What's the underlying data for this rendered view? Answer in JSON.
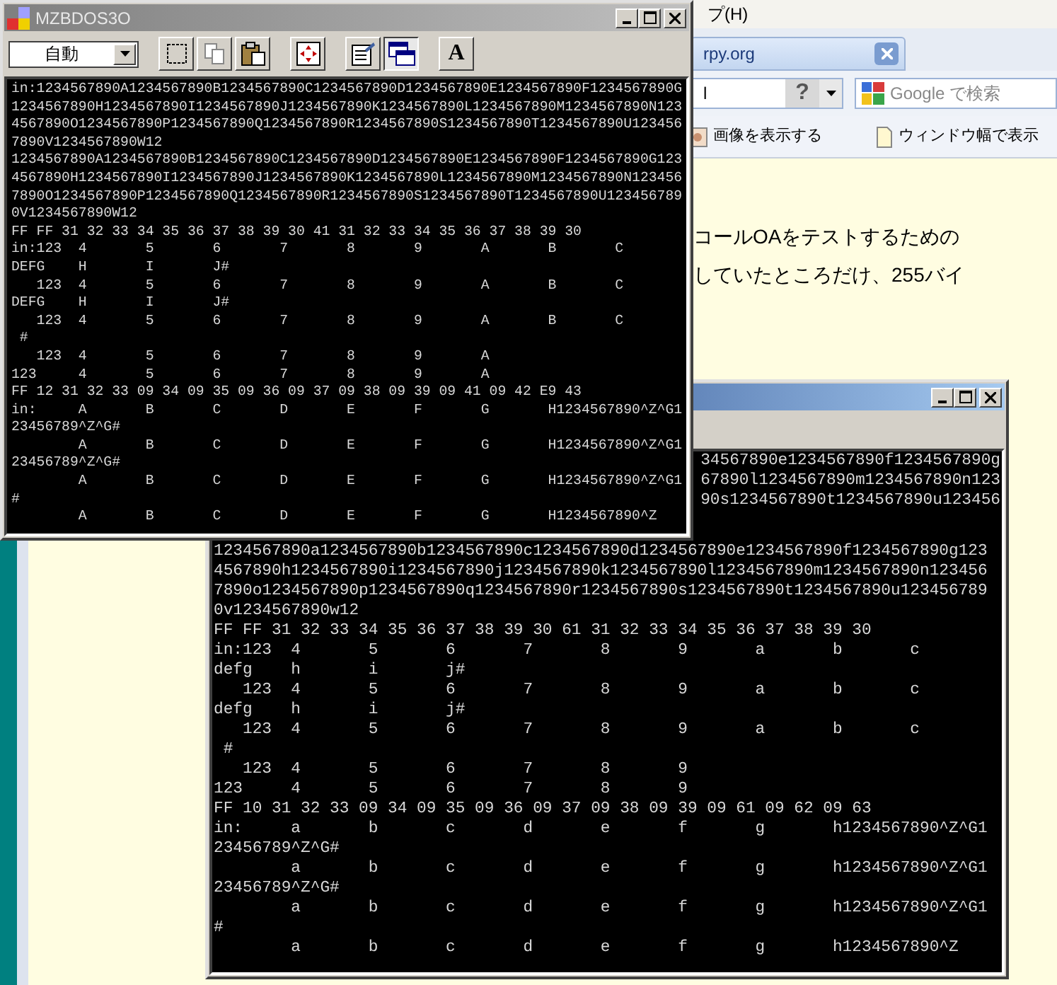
{
  "front_window": {
    "title": "MZBDOS3O",
    "encoding": "自動",
    "tools": [
      {
        "kind": "select",
        "selected": false
      },
      {
        "kind": "copy",
        "selected": false
      },
      {
        "kind": "paste",
        "selected": false
      },
      {
        "kind": "fullscreen",
        "selected": false
      },
      {
        "kind": "properties",
        "selected": false
      },
      {
        "kind": "background",
        "selected": true
      },
      {
        "kind": "font",
        "label": "A",
        "selected": false
      }
    ],
    "lines": [
      "in:1234567890A1234567890B1234567890C1234567890D1234567890E1234567890F1234567890G",
      "1234567890H1234567890I1234567890J1234567890K1234567890L1234567890M1234567890N123",
      "4567890O1234567890P1234567890Q1234567890R1234567890S1234567890T1234567890U123456",
      "7890V1234567890W12",
      "1234567890A1234567890B1234567890C1234567890D1234567890E1234567890F1234567890G123",
      "4567890H1234567890I1234567890J1234567890K1234567890L1234567890M1234567890N123456",
      "7890O1234567890P1234567890Q1234567890R1234567890S1234567890T1234567890U123456789",
      "0V1234567890W12",
      "FF FF 31 32 33 34 35 36 37 38 39 30 41 31 32 33 34 35 36 37 38 39 30",
      "in:123  4       5       6       7       8       9       A       B       C",
      "DEFG    H       I       J#",
      "   123  4       5       6       7       8       9       A       B       C",
      "DEFG    H       I       J#",
      "   123  4       5       6       7       8       9       A       B       C",
      " #",
      "   123  4       5       6       7       8       9       A",
      "123     4       5       6       7       8       9       A",
      "FF 12 31 32 33 09 34 09 35 09 36 09 37 09 38 09 39 09 41 09 42 E9 43",
      "in:     A       B       C       D       E       F       G       H1234567890^Z^G1",
      "23456789^Z^G#",
      "        A       B       C       D       E       F       G       H1234567890^Z^G1",
      "23456789^Z^G#",
      "        A       B       C       D       E       F       G       H1234567890^Z^G1",
      "#",
      "        A       B       C       D       E       F       G       H1234567890^Z"
    ]
  },
  "browser": {
    "menu_item": "プ(H)",
    "tab": {
      "label": "rpy.org"
    },
    "address": {
      "value": "l"
    },
    "help_button": "?",
    "search": {
      "placeholder": "Google で検索"
    },
    "links": [
      "画像を表示する",
      "ウィンドウ幅で表示"
    ],
    "content_lines": [
      "コールOAをテストするための",
      "していたところだけ、255バイ"
    ]
  },
  "back_window": {
    "partial_lines": [
      "34567890e1234567890f1234567890g",
      "67890l1234567890m1234567890n123",
      "90s1234567890t1234567890u123456"
    ],
    "lines": [
      "1234567890a1234567890b1234567890c1234567890d1234567890e1234567890f1234567890g123",
      "4567890h1234567890i1234567890j1234567890k1234567890l1234567890m1234567890n123456",
      "7890o1234567890p1234567890q1234567890r1234567890s1234567890t1234567890u123456789",
      "0v1234567890w12",
      "FF FF 31 32 33 34 35 36 37 38 39 30 61 31 32 33 34 35 36 37 38 39 30",
      "in:123  4       5       6       7       8       9       a       b       c",
      "defg    h       i       j#",
      "   123  4       5       6       7       8       9       a       b       c",
      "defg    h       i       j#",
      "   123  4       5       6       7       8       9       a       b       c",
      " #",
      "   123  4       5       6       7       8       9",
      "123     4       5       6       7       8       9",
      "FF 10 31 32 33 09 34 09 35 09 36 09 37 09 38 09 39 09 61 09 62 09 63",
      "in:     a       b       c       d       e       f       g       h1234567890^Z^G1",
      "23456789^Z^G#",
      "        a       b       c       d       e       f       g       h1234567890^Z^G1",
      "23456789^Z^G#",
      "        a       b       c       d       e       f       g       h1234567890^Z^G1",
      "#",
      "        a       b       c       d       e       f       g       h1234567890^Z"
    ]
  }
}
